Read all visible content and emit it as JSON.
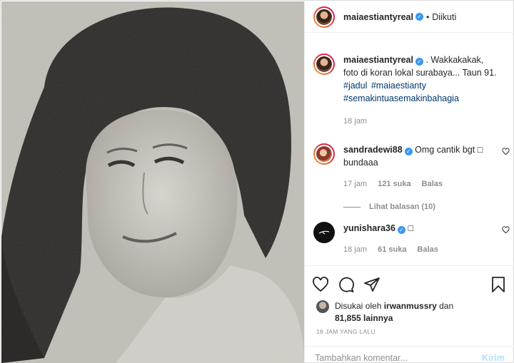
{
  "post": {
    "image_alt": "black and white newspaper photo of a young woman",
    "author": "maiaestiantyreal",
    "follow_status": "Diikuti",
    "separator": "•"
  },
  "caption": {
    "username": "maiaestiantyreal",
    "text": ". Wakkakakak, foto di koran lokal surabaya... Taun 91.",
    "hashtags": "#jadul #maiaestianty #semakintuasemakinbahagia",
    "time": "18 jam"
  },
  "comments": [
    {
      "username": "sandradewi88",
      "text": "Omg cantik bgt □ bundaaa",
      "time": "17 jam",
      "likes": "121 suka",
      "reply": "Balas",
      "view_replies": "Lihat balasan (10)"
    },
    {
      "username": "yunishara36",
      "text": "□",
      "time": "18 jam",
      "likes": "61 suka",
      "reply": "Balas"
    }
  ],
  "likes": {
    "prefix": "Disukai oleh",
    "user": "irwanmussry",
    "middle": "dan",
    "count": "81,855 lainnya"
  },
  "timestamp": "18 JAM YANG LALU",
  "add_comment": {
    "placeholder": "Tambahkan komentar...",
    "send_label": "Kirim"
  },
  "icons": [
    "heart-icon",
    "comment-icon",
    "share-icon",
    "bookmark-icon"
  ],
  "colors": {
    "link": "#00376b",
    "verified": "#3897f0",
    "muted": "#8e8e8e"
  }
}
